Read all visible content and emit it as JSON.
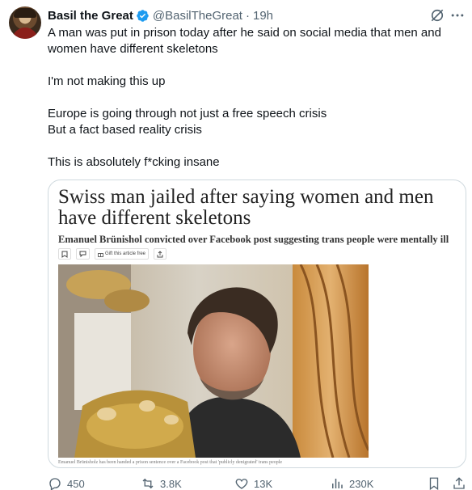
{
  "author": {
    "name": "Basil the Great",
    "handle": "@BasilTheGreat",
    "separator": "·",
    "time": "19h",
    "verified_icon": "verified-badge-icon",
    "verified_color": "#1d9bf0"
  },
  "tweet": {
    "lines": [
      "A man was put in prison today after he said on social media that men and women have different skeletons",
      "",
      "I'm not making this up",
      "",
      "Europe is going through not just a free speech crisis",
      "But a fact based reality crisis",
      "",
      "This is absolutely f*cking insane"
    ]
  },
  "article": {
    "headline": "Swiss man jailed after saying women and men have different skeletons",
    "standfirst": "Emanuel Brünishol convicted over Facebook post suggesting trans people were mentally ill",
    "tools": {
      "gift": "Gift this article free"
    },
    "caption": "Emanuel Brünisholz has been handed a prison sentence over a Facebook post that 'publicly denigrated' trans people"
  },
  "actions": {
    "replies": "450",
    "reposts": "3.8K",
    "likes": "13K",
    "views": "230K"
  },
  "colors": {
    "muted": "#536471",
    "text": "#0f1419",
    "border": "#cfd9de"
  }
}
